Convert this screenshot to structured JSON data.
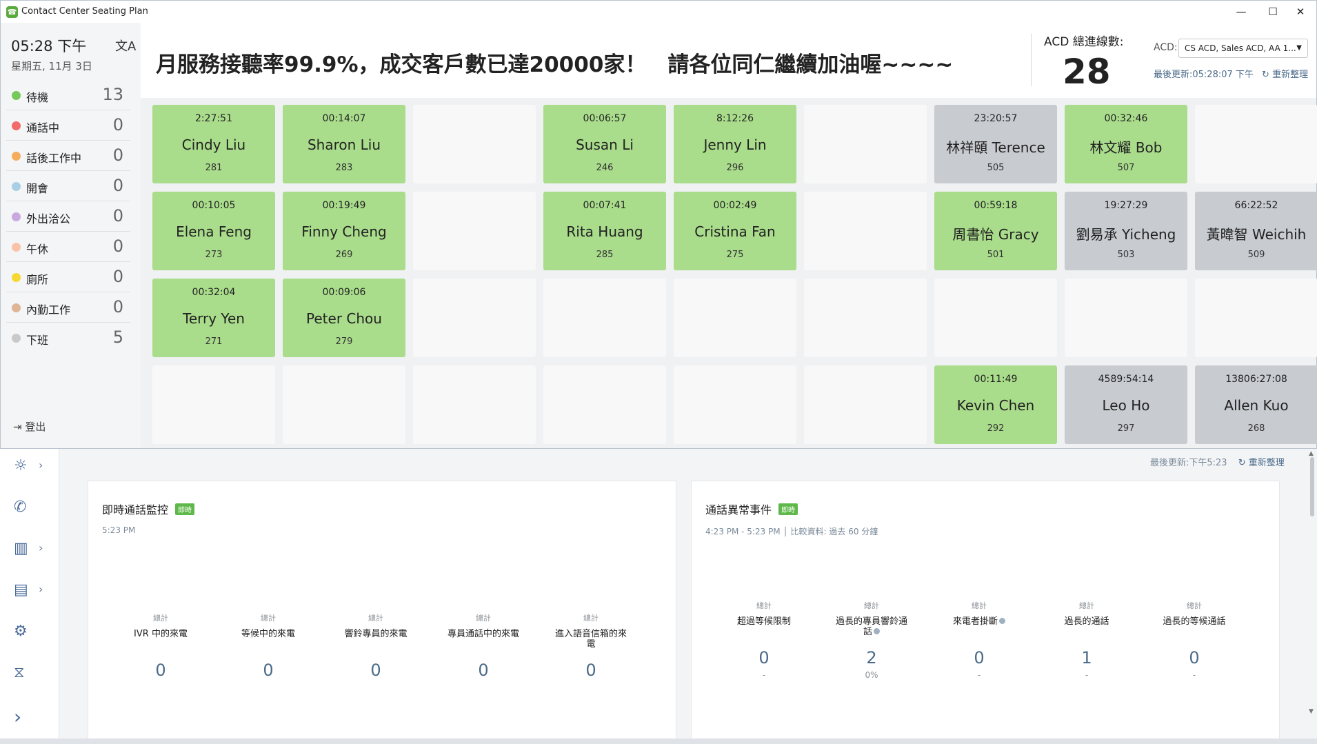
{
  "window": {
    "title": "Contact Center Seating Plan",
    "app_icon": "headset-icon",
    "minimize": "—",
    "maximize": "☐",
    "close": "✕"
  },
  "sidebar": {
    "time": "05:28 下午",
    "date": "星期五, 11月 3日",
    "language_icon": "translate-icon",
    "statuses": [
      {
        "label": "待機",
        "count": "13",
        "color": "#74c95a"
      },
      {
        "label": "通話中",
        "count": "0",
        "color": "#f46a6a"
      },
      {
        "label": "話後工作中",
        "count": "0",
        "color": "#f5ad5b"
      },
      {
        "label": "開會",
        "count": "0",
        "color": "#a9cfe6"
      },
      {
        "label": "外出洽公",
        "count": "0",
        "color": "#c9a9dd"
      },
      {
        "label": "午休",
        "count": "0",
        "color": "#fac3a8"
      },
      {
        "label": "廁所",
        "count": "0",
        "color": "#f7d732"
      },
      {
        "label": "內勤工作",
        "count": "0",
        "color": "#deb596"
      },
      {
        "label": "下班",
        "count": "5",
        "color": "#c9c9c9"
      }
    ],
    "logout": "登出"
  },
  "header": {
    "ticker": "月服務接聽率99.9%，成交客戶數已達20000家！　請各位同仁繼續加油喔~~~~",
    "acd_total_label": "ACD 總進線數:",
    "acd_total": "28",
    "acd_label": "ACD:",
    "acd_selected": "CS ACD, Sales ACD, AA 1...",
    "last_updated": "最後更新:05:28:07 下午",
    "refresh": "重新整理"
  },
  "colors": {
    "available": "#a9dc8b",
    "offline": "#c8cbd0",
    "empty": "#f8f8f8"
  },
  "seats": [
    {
      "row": 0,
      "col": 0,
      "state": "green",
      "time": "2:27:51",
      "name": "Cindy Liu",
      "ext": "281"
    },
    {
      "row": 0,
      "col": 1,
      "state": "green",
      "time": "00:14:07",
      "name": "Sharon Liu",
      "ext": "283"
    },
    {
      "row": 0,
      "col": 2,
      "state": "empty"
    },
    {
      "row": 0,
      "col": 3,
      "state": "green",
      "time": "00:06:57",
      "name": "Susan Li",
      "ext": "246"
    },
    {
      "row": 0,
      "col": 4,
      "state": "green",
      "time": "8:12:26",
      "name": "Jenny Lin",
      "ext": "296"
    },
    {
      "row": 0,
      "col": 5,
      "state": "empty"
    },
    {
      "row": 0,
      "col": 6,
      "state": "gray",
      "time": "23:20:57",
      "name": "林祥頤 Terence",
      "ext": "505"
    },
    {
      "row": 0,
      "col": 7,
      "state": "green",
      "time": "00:32:46",
      "name": "林文耀 Bob",
      "ext": "507"
    },
    {
      "row": 0,
      "col": 8,
      "state": "empty"
    },
    {
      "row": 1,
      "col": 0,
      "state": "green",
      "time": "00:10:05",
      "name": "Elena Feng",
      "ext": "273"
    },
    {
      "row": 1,
      "col": 1,
      "state": "green",
      "time": "00:19:49",
      "name": "Finny Cheng",
      "ext": "269"
    },
    {
      "row": 1,
      "col": 2,
      "state": "empty"
    },
    {
      "row": 1,
      "col": 3,
      "state": "green",
      "time": "00:07:41",
      "name": "Rita Huang",
      "ext": "285"
    },
    {
      "row": 1,
      "col": 4,
      "state": "green",
      "time": "00:02:49",
      "name": "Cristina Fan",
      "ext": "275"
    },
    {
      "row": 1,
      "col": 5,
      "state": "empty"
    },
    {
      "row": 1,
      "col": 6,
      "state": "green",
      "time": "00:59:18",
      "name": "周書怡 Gracy",
      "ext": "501"
    },
    {
      "row": 1,
      "col": 7,
      "state": "gray",
      "time": "19:27:29",
      "name": "劉易承 Yicheng",
      "ext": "503"
    },
    {
      "row": 1,
      "col": 8,
      "state": "gray",
      "time": "66:22:52",
      "name": "黃暐智 Weichih",
      "ext": "509"
    },
    {
      "row": 2,
      "col": 0,
      "state": "green",
      "time": "00:32:04",
      "name": "Terry Yen",
      "ext": "271"
    },
    {
      "row": 2,
      "col": 1,
      "state": "green",
      "time": "00:09:06",
      "name": "Peter Chou",
      "ext": "279"
    },
    {
      "row": 2,
      "col": 2,
      "state": "empty"
    },
    {
      "row": 2,
      "col": 3,
      "state": "empty"
    },
    {
      "row": 2,
      "col": 4,
      "state": "empty"
    },
    {
      "row": 2,
      "col": 5,
      "state": "empty"
    },
    {
      "row": 2,
      "col": 6,
      "state": "empty"
    },
    {
      "row": 2,
      "col": 7,
      "state": "empty"
    },
    {
      "row": 2,
      "col": 8,
      "state": "empty"
    },
    {
      "row": 3,
      "col": 0,
      "state": "empty"
    },
    {
      "row": 3,
      "col": 1,
      "state": "empty"
    },
    {
      "row": 3,
      "col": 2,
      "state": "empty"
    },
    {
      "row": 3,
      "col": 3,
      "state": "empty"
    },
    {
      "row": 3,
      "col": 4,
      "state": "empty"
    },
    {
      "row": 3,
      "col": 5,
      "state": "empty"
    },
    {
      "row": 3,
      "col": 6,
      "state": "green",
      "time": "00:11:49",
      "name": "Kevin Chen",
      "ext": "292"
    },
    {
      "row": 3,
      "col": 7,
      "state": "gray",
      "time": "4589:54:14",
      "name": "Leo Ho",
      "ext": "297"
    },
    {
      "row": 3,
      "col": 8,
      "state": "gray",
      "time": "13806:27:08",
      "name": "Allen Kuo",
      "ext": "268"
    }
  ],
  "dashboard": {
    "last_updated": "最後更新:下午5:23",
    "refresh": "重新整理",
    "nav": [
      {
        "icon": "lightbulb-icon",
        "glyph": "☼",
        "chevron": true
      },
      {
        "icon": "phone-icon",
        "glyph": "✆",
        "chevron": false
      },
      {
        "icon": "chart-icon",
        "glyph": "▥",
        "chevron": true
      },
      {
        "icon": "report-icon",
        "glyph": "▤",
        "chevron": true
      },
      {
        "icon": "gear-icon",
        "glyph": "⚙",
        "chevron": false
      },
      {
        "icon": "handshake-icon",
        "glyph": "⧖",
        "chevron": false
      }
    ],
    "expand_glyph": "›",
    "card1": {
      "title": "即時通話監控",
      "badge": "即時",
      "subtitle": "5:23 PM",
      "metrics": [
        {
          "top": "總計",
          "label": "IVR 中的來電",
          "value": "0"
        },
        {
          "top": "總計",
          "label": "等候中的來電",
          "value": "0"
        },
        {
          "top": "總計",
          "label": "響鈴專員的來電",
          "value": "0"
        },
        {
          "top": "總計",
          "label": "專員通話中的來電",
          "value": "0"
        },
        {
          "top": "總計",
          "label": "進入語音信箱的來電",
          "value": "0"
        }
      ]
    },
    "card2": {
      "title": "通話異常事件",
      "badge": "即時",
      "subtitle": "4:23 PM - 5:23 PM  │  比較資料: 過去 60 分鐘",
      "metrics": [
        {
          "top": "總計",
          "label": "超過等候限制",
          "value": "0",
          "sub": "-"
        },
        {
          "top": "總計",
          "label": "過長的專員響鈴通話",
          "value": "2",
          "sub": "0%",
          "info": true
        },
        {
          "top": "總計",
          "label": "來電者掛斷",
          "value": "0",
          "sub": "-",
          "info": true
        },
        {
          "top": "總計",
          "label": "過長的通話",
          "value": "1",
          "sub": "-"
        },
        {
          "top": "總計",
          "label": "過長的等候通話",
          "value": "0",
          "sub": "-"
        }
      ]
    }
  }
}
